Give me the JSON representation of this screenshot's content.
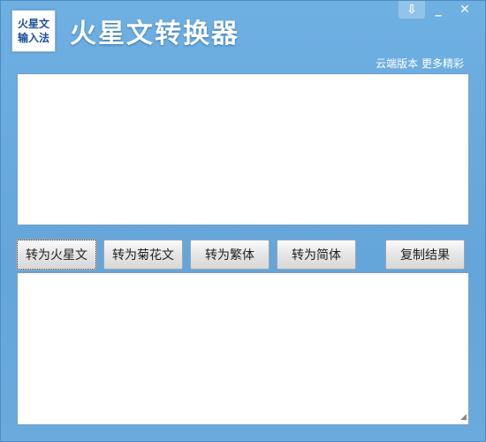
{
  "logo": {
    "line1": "火星文",
    "line2": "输入法"
  },
  "app_title": "火星文转换器",
  "window_controls": {
    "menu": "⇩",
    "minimize": "_",
    "close": "✕"
  },
  "cloud_link": "云端版本 更多精彩",
  "input": {
    "value": "",
    "placeholder": ""
  },
  "buttons": {
    "to_martian": "转为火星文",
    "to_chrysanthemum": "转为菊花文",
    "to_traditional": "转为繁体",
    "to_simplified": "转为简体",
    "copy_result": "复制结果"
  },
  "output": {
    "value": "",
    "placeholder": ""
  },
  "colors": {
    "window_bg": "#6aa8dc",
    "title_text": "#ffffff",
    "logo_text": "#1a4f9a"
  }
}
